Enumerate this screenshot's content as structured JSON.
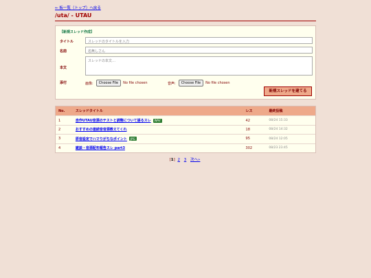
{
  "nav": {
    "back_link": "← 板一覧（トップ）へ戻る"
  },
  "board": {
    "title": "/uta/ - UTAU"
  },
  "form": {
    "heading": "【新規スレッド作成】",
    "title_label": "タイトル",
    "title_placeholder": "スレッドのタイトルを入力",
    "name_label": "名前",
    "name_placeholder": "名無しさん",
    "body_label": "本文",
    "body_placeholder": "スレッドの本文…",
    "attach_label": "添付",
    "image_label": "画像:",
    "audio_label": "音声:",
    "file_button": "Choose File",
    "no_file": "No file chosen",
    "submit_label": "新規スレッドを建てる"
  },
  "table": {
    "headers": {
      "no": "No.",
      "title": "スレッドタイトル",
      "res": "レス",
      "date": "最終投稿"
    },
    "rows": [
      {
        "no": "1",
        "title": "自作UTAU音源のテストと調整について語るスレ",
        "badge": "WAV",
        "res": "42",
        "date": "08/24 15:33"
      },
      {
        "no": "2",
        "title": "おすすめの連続音音源教えてくれ",
        "badge": "",
        "res": "18",
        "date": "08/24 14:32"
      },
      {
        "no": "3",
        "title": "原音設定でハマりがちなポイント",
        "badge": "JPG",
        "res": "95",
        "date": "08/24 12:05"
      },
      {
        "no": "4",
        "title": "雑談・音源配布報告スレ part3",
        "badge": "",
        "res": "302",
        "date": "08/23 23:45"
      }
    ]
  },
  "pager": {
    "open": "[",
    "current": "1",
    "close": "]",
    "p2": "2",
    "p3": "3",
    "next": "次へ»"
  },
  "colors": {
    "bg": "#f0e0d6",
    "header": "#eea98a",
    "panel": "#ffffee",
    "badge": "#2e7d32"
  }
}
